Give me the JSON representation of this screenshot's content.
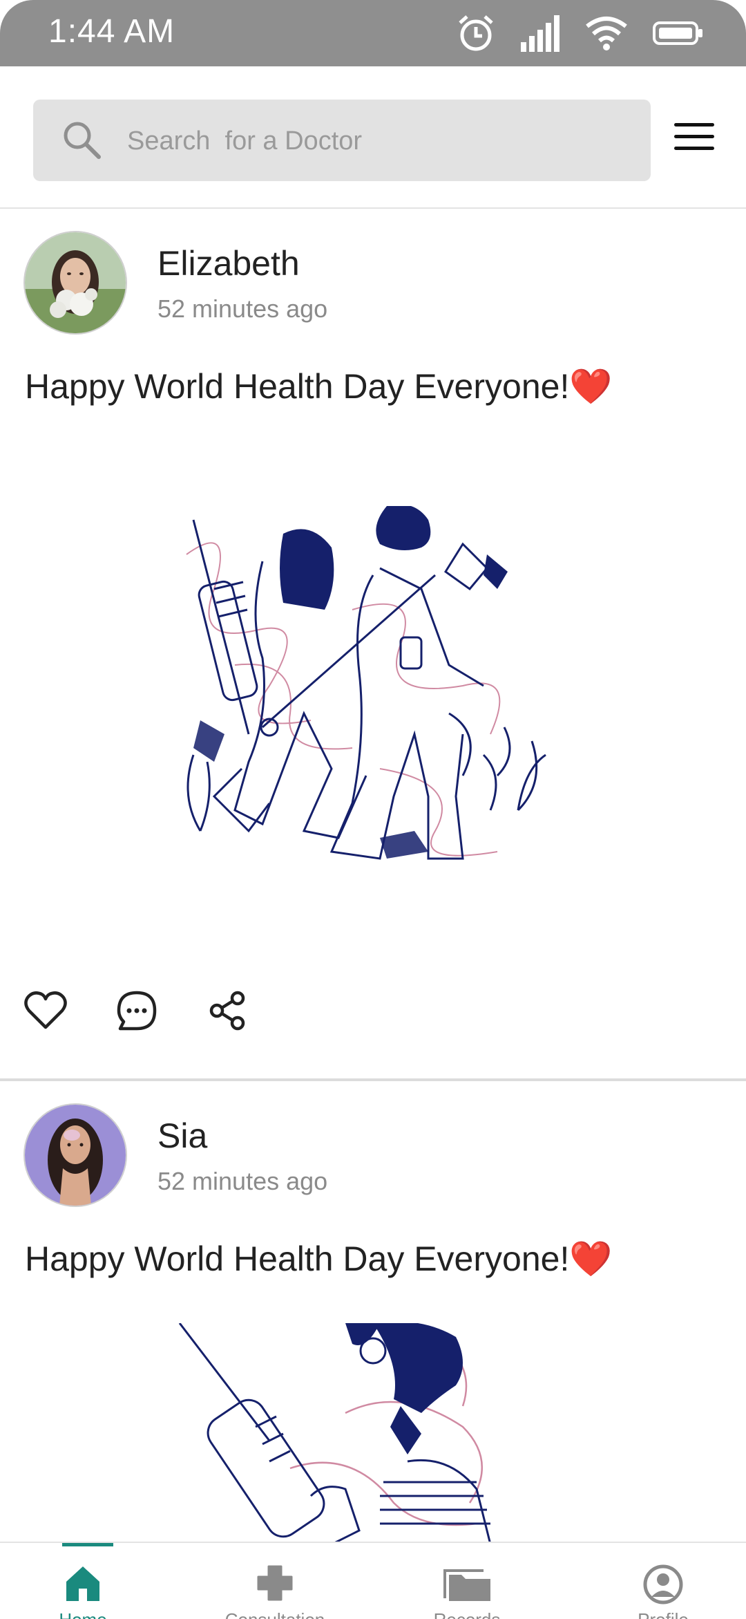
{
  "status_bar": {
    "time": "1:44 AM"
  },
  "search": {
    "placeholder": "Search  for a Doctor"
  },
  "posts": [
    {
      "author": "Elizabeth",
      "time": "52 minutes ago",
      "text": "Happy World Health Day Everyone!❤️"
    },
    {
      "author": "Sia",
      "time": "52 minutes ago",
      "text": "Happy World Health Day Everyone!❤️"
    }
  ],
  "bottom_nav": [
    {
      "label": "Home",
      "icon": "home-icon",
      "active": true
    },
    {
      "label": "Consultation",
      "icon": "plus-cross-icon",
      "active": false
    },
    {
      "label": "Records",
      "icon": "folder-icon",
      "active": false
    },
    {
      "label": "Profile",
      "icon": "user-circle-icon",
      "active": false
    }
  ],
  "colors": {
    "accent": "#1a8a7e",
    "status_bar": "#8f8f8f",
    "illustration_navy": "#15206b",
    "illustration_pink": "#d08aa2"
  }
}
